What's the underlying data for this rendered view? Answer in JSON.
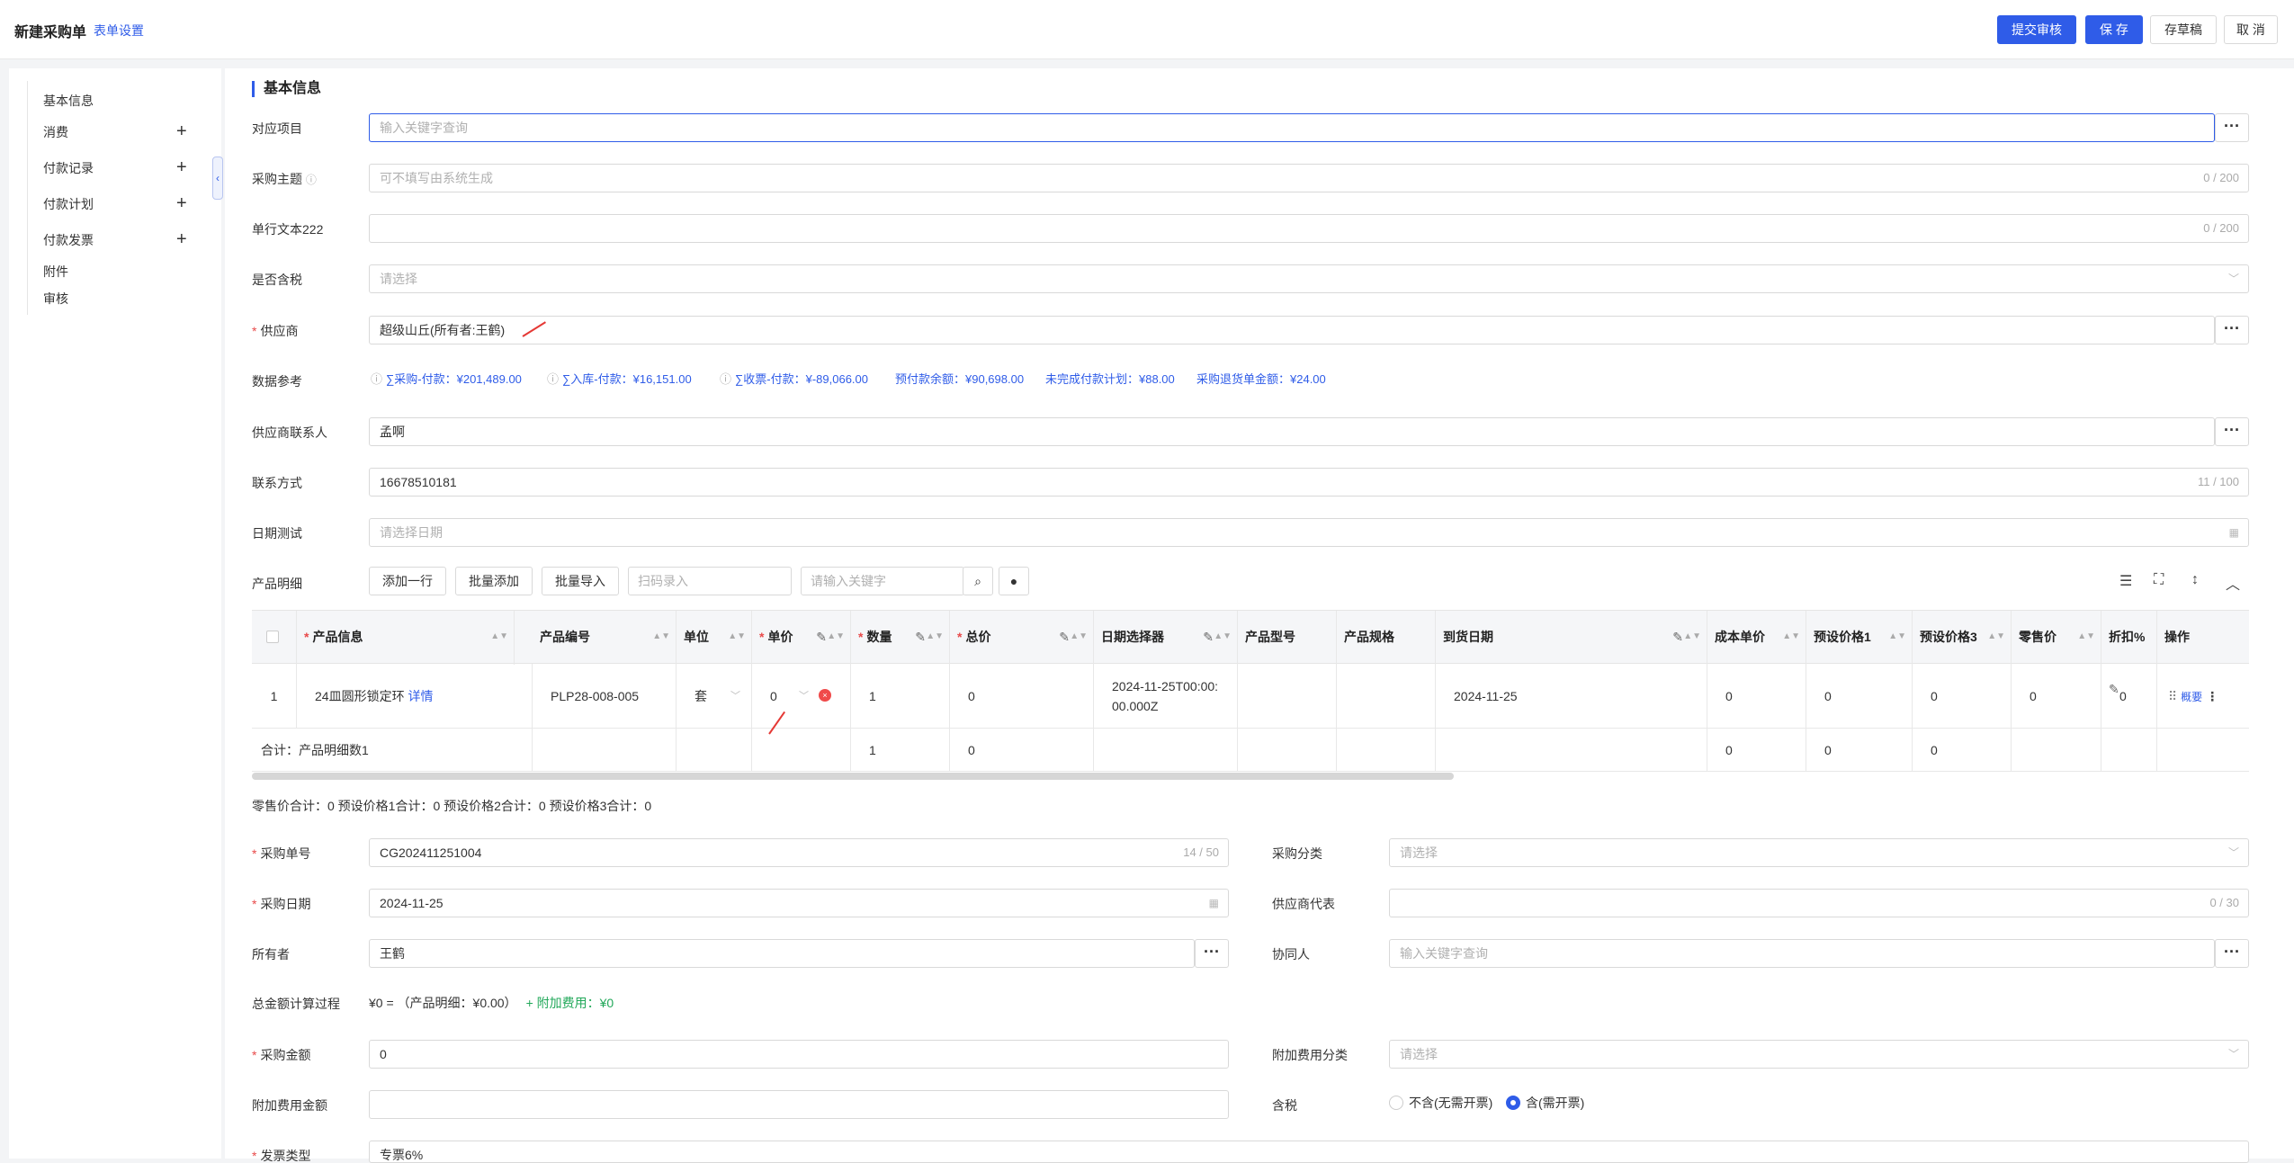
{
  "header": {
    "title": "新建采购单",
    "settings_link": "表单设置",
    "submit_label": "提交审核",
    "save_label": "保 存",
    "draft_label": "存草稿",
    "cancel_label": "取 消"
  },
  "sidebar": {
    "items": [
      {
        "label": "基本信息",
        "expandable": false
      },
      {
        "label": "消费",
        "expandable": true
      },
      {
        "label": "付款记录",
        "expandable": true
      },
      {
        "label": "付款计划",
        "expandable": true
      },
      {
        "label": "付款发票",
        "expandable": true
      },
      {
        "label": "附件",
        "expandable": false
      },
      {
        "label": "审核",
        "expandable": false
      }
    ],
    "plus_glyph": "+",
    "collapse_glyph": "‹"
  },
  "section": {
    "title": "基本信息"
  },
  "form": {
    "project": {
      "label": "对应项目",
      "placeholder": "输入关键字查询"
    },
    "subject": {
      "label": "采购主题",
      "placeholder": "可不填写由系统生成",
      "counter": "0 / 200"
    },
    "single_text": {
      "label": "单行文本222",
      "counter": "0 / 200"
    },
    "tax_included": {
      "label": "是否含税",
      "placeholder": "请选择"
    },
    "supplier": {
      "label": "供应商",
      "value": "超级山丘(所有者:王鹤)"
    },
    "data_ref": {
      "label": "数据参考",
      "items": [
        "∑采购-付款：¥201,489.00",
        "∑入库-付款：¥16,151.00",
        "∑收票-付款：¥-89,066.00",
        "预付款余额：¥90,698.00",
        "未完成付款计划：¥88.00",
        "采购退货单金额：¥24.00"
      ]
    },
    "contact": {
      "label": "供应商联系人",
      "value": "孟啊"
    },
    "phone": {
      "label": "联系方式",
      "value": "16678510181",
      "counter": "11 / 100"
    },
    "date_test": {
      "label": "日期测试",
      "placeholder": "请选择日期"
    }
  },
  "products": {
    "label": "产品明细",
    "add_row": "添加一行",
    "batch_add": "批量添加",
    "batch_import": "批量导入",
    "scan_placeholder": "扫码录入",
    "keyword_placeholder": "请输入关键字",
    "columns": [
      "产品信息",
      "产品编号",
      "单位",
      "单价",
      "数量",
      "总价",
      "日期选择器",
      "产品型号",
      "产品规格",
      "到货日期",
      "成本单价",
      "预设价格1",
      "预设价格3",
      "零售价",
      "折扣%",
      "操作"
    ],
    "rows": [
      {
        "index": "1",
        "product": "24皿圆形锁定环",
        "detail_link": "详情",
        "code": "PLP28-008-005",
        "unit": "套",
        "price": "0",
        "qty": "1",
        "total": "0",
        "datetime_line1": "2024-11-25T00:00:",
        "datetime_line2": "00.000Z",
        "arrival": "2024-11-25",
        "cost": "0",
        "preset1": "0",
        "preset3": "0",
        "retail": "0",
        "discount": "0",
        "action": "概要"
      }
    ],
    "summary": {
      "label": "合计：产品明细数1",
      "qty": "1",
      "total": "0",
      "cost": "0",
      "preset1": "0",
      "preset3": "0"
    }
  },
  "totals_line": "零售价合计：0  预设价格1合计：0  预设价格2合计：0  预设价格3合计：0",
  "order": {
    "number": {
      "label": "采购单号",
      "value": "CG202411251004",
      "counter": "14 / 50"
    },
    "category": {
      "label": "采购分类",
      "placeholder": "请选择"
    },
    "date": {
      "label": "采购日期",
      "value": "2024-11-25"
    },
    "supplier_rep": {
      "label": "供应商代表",
      "counter": "0 / 30"
    },
    "owner": {
      "label": "所有者",
      "value": "王鹤"
    },
    "collaborator": {
      "label": "协同人",
      "placeholder": "输入关键字查询"
    },
    "calc": {
      "label": "总金额计算过程",
      "text": "¥0 = （产品明细：¥0.00）",
      "extra": "+ 附加费用：¥0"
    },
    "amount": {
      "label": "采购金额",
      "value": "0"
    },
    "extra_category": {
      "label": "附加费用分类",
      "placeholder": "请选择"
    },
    "extra_amount": {
      "label": "附加费用金额"
    },
    "tax": {
      "label": "含税",
      "option1": "不含(无需开票)",
      "option2": "含(需开票)"
    },
    "invoice_type": {
      "label": "发票类型",
      "value": "专票6%"
    }
  }
}
